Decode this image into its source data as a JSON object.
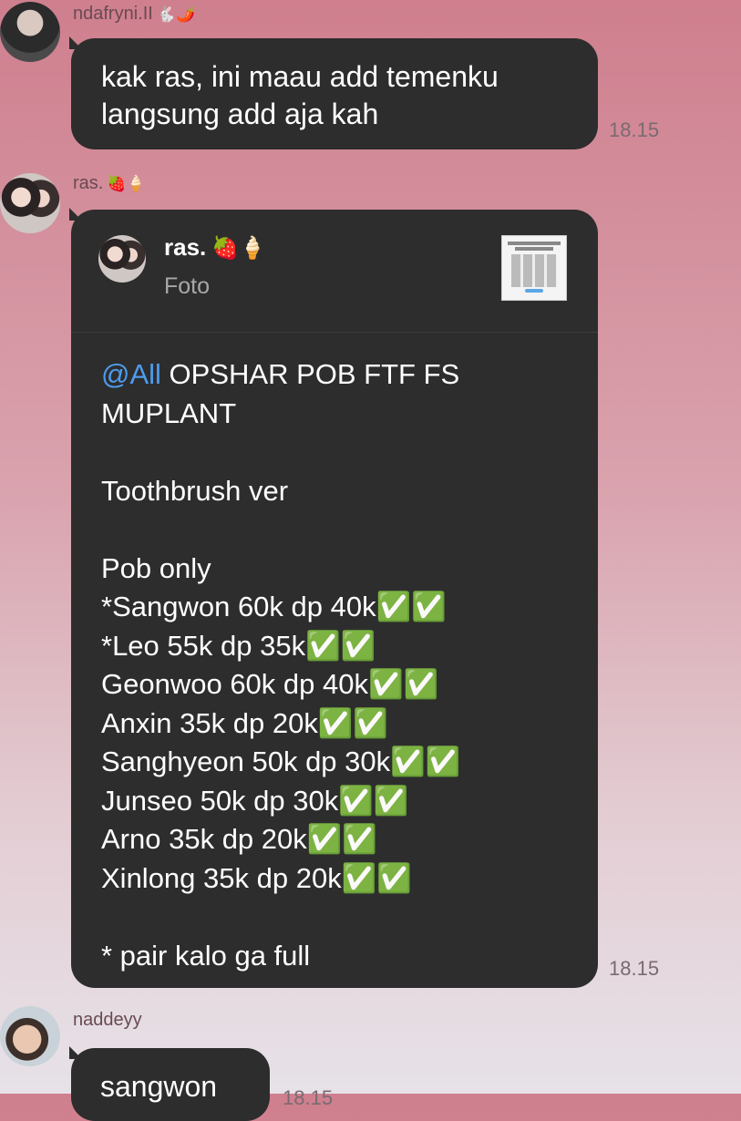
{
  "messages": [
    {
      "sender": "ndafryni.II",
      "sender_emoji": "🐇🌶️",
      "text_lines": [
        "kak ras, ini maau add temenku",
        "langsung add aja kah"
      ],
      "time": "18.15"
    },
    {
      "sender": "ras.",
      "sender_emoji": "🍓🍦",
      "reply": {
        "name": "ras.",
        "name_emoji": "🍓🍦",
        "subtitle": "Foto"
      },
      "mention": "@All",
      "body_first": " OPSHAR POB FTF FS",
      "body_rest": "MUPLANT\n\nToothbrush ver\n\nPob only\n*Sangwon 60k dp 40k✅✅\n*Leo 55k dp 35k✅✅\nGeonwoo 60k dp 40k✅✅\nAnxin 35k dp 20k✅✅\nSanghyeon 50k dp 30k✅✅\nJunseo 50k dp 30k✅✅\nArno 35k dp 20k✅✅\nXinlong 35k dp 20k✅✅\n\n* pair kalo ga full",
      "time": "18.15"
    },
    {
      "sender": "naddeyy",
      "text": "sangwon",
      "time": "18.15"
    }
  ],
  "colors": {
    "bubble": "#2d2d2d",
    "mention": "#4e9cf0"
  },
  "icons": [
    "checkmark-emoji",
    "strawberry-emoji",
    "ice-cream-emoji"
  ]
}
